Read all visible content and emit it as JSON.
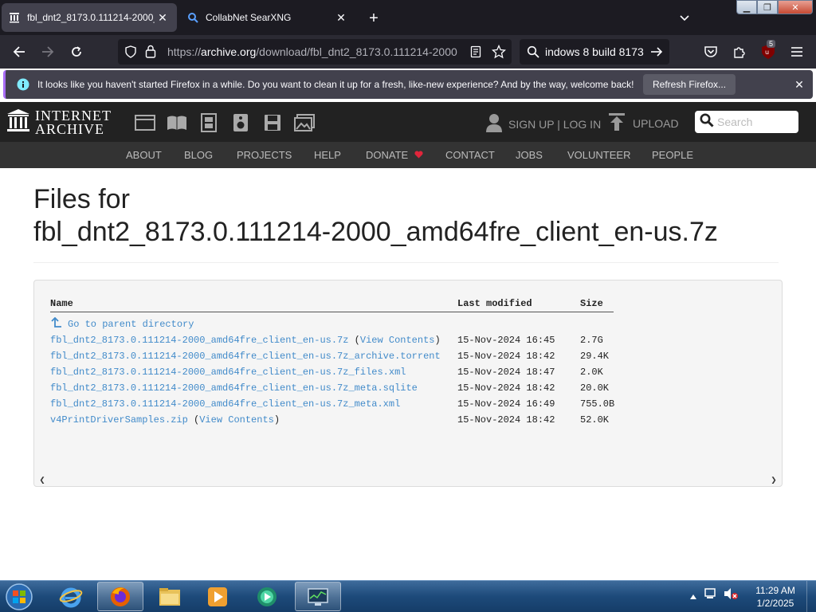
{
  "browser": {
    "tabs": [
      {
        "title": "fbl_dnt2_8173.0.111214-2000_a",
        "active": true,
        "favicon": "archive-icon"
      },
      {
        "title": "CollabNet SearXNG",
        "active": false,
        "favicon": "search-icon"
      }
    ],
    "url": {
      "protocol": "https://",
      "domain": "archive.org",
      "path": "/download/fbl_dnt2_8173.0.111214-2000"
    },
    "search_text": "indows 8 build 8173",
    "extension_badge": "5",
    "notification": {
      "text": "It looks like you haven't started Firefox in a while. Do you want to clean it up for a fresh, like-new experience? And by the way, welcome back!",
      "button": "Refresh Firefox..."
    }
  },
  "ia": {
    "logo_line1": "INTERNET",
    "logo_line2": "ARCHIVE",
    "signin": "SIGN UP | LOG IN",
    "upload": "UPLOAD",
    "search_placeholder": "Search",
    "nav": [
      "ABOUT",
      "BLOG",
      "PROJECTS",
      "HELP",
      "DONATE",
      "CONTACT",
      "JOBS",
      "VOLUNTEER",
      "PEOPLE"
    ]
  },
  "page": {
    "title_line1": "Files for",
    "title_line2": "fbl_dnt2_8173.0.111214-2000_amd64fre_client_en-us.7z",
    "columns": {
      "name": "Name",
      "modified": "Last modified",
      "size": "Size"
    },
    "parent_link": "Go to parent directory",
    "view_contents": "View Contents",
    "files": [
      {
        "name": "fbl_dnt2_8173.0.111214-2000_amd64fre_client_en-us.7z",
        "view_contents": true,
        "modified": "15-Nov-2024 16:45",
        "size": "2.7G"
      },
      {
        "name": "fbl_dnt2_8173.0.111214-2000_amd64fre_client_en-us.7z_archive.torrent",
        "view_contents": false,
        "modified": "15-Nov-2024 18:42",
        "size": "29.4K"
      },
      {
        "name": "fbl_dnt2_8173.0.111214-2000_amd64fre_client_en-us.7z_files.xml",
        "view_contents": false,
        "modified": "15-Nov-2024 18:47",
        "size": "2.0K"
      },
      {
        "name": "fbl_dnt2_8173.0.111214-2000_amd64fre_client_en-us.7z_meta.sqlite",
        "view_contents": false,
        "modified": "15-Nov-2024 18:42",
        "size": "20.0K"
      },
      {
        "name": "fbl_dnt2_8173.0.111214-2000_amd64fre_client_en-us.7z_meta.xml",
        "view_contents": false,
        "modified": "15-Nov-2024 16:49",
        "size": "755.0B"
      },
      {
        "name": "v4PrintDriverSamples.zip",
        "view_contents": true,
        "modified": "15-Nov-2024 18:42",
        "size": "52.0K"
      }
    ]
  },
  "taskbar": {
    "time": "11:29 AM",
    "date": "1/2/2025"
  },
  "colors": {
    "link": "#428bca",
    "donate_heart": "#e0253b",
    "notice_accent": "#a86cf5"
  }
}
